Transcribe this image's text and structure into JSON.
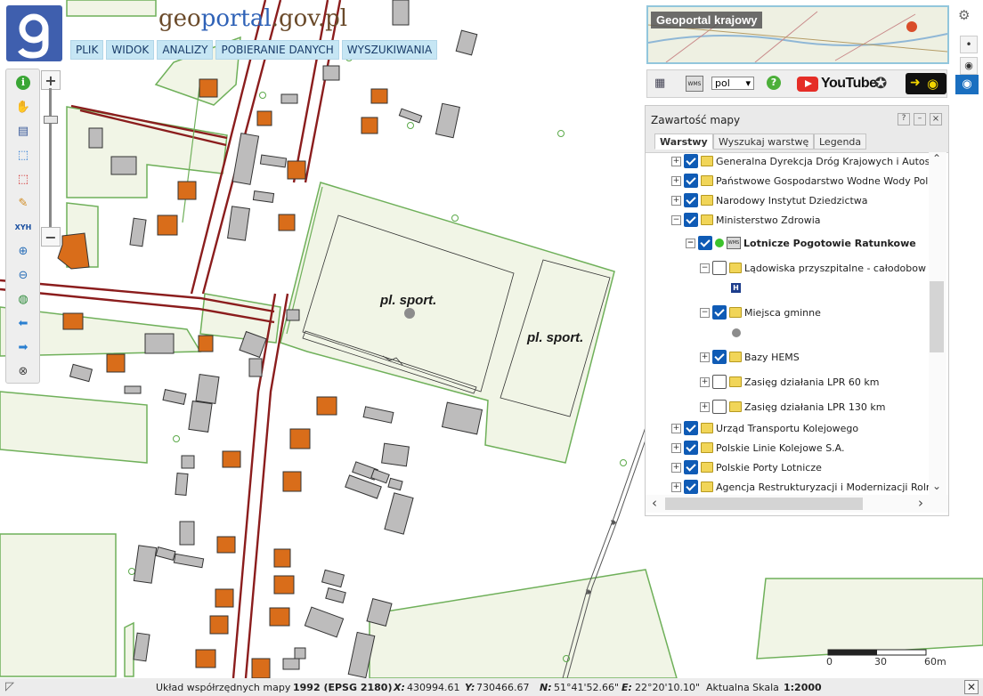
{
  "app": {
    "brand_part1": "geo",
    "brand_part2": "portal",
    "brand_part3": ".gov.pl",
    "logo_glyph": "g"
  },
  "menu": [
    "PLIK",
    "WIDOK",
    "ANALIZY",
    "POBIERANIE DANYCH",
    "WYSZUKIWANIA"
  ],
  "toolbar_tools": [
    {
      "name": "info-icon",
      "glyph": "i"
    },
    {
      "name": "pan-hand-icon",
      "glyph": "✋"
    },
    {
      "name": "legend-list-icon",
      "glyph": "▤"
    },
    {
      "name": "select-rectangle-icon",
      "glyph": "⬚"
    },
    {
      "name": "select-red-icon",
      "glyph": "⬚"
    },
    {
      "name": "pencil-icon",
      "glyph": "✎"
    },
    {
      "name": "xyh-coordinates-icon",
      "glyph": "XYH"
    },
    {
      "name": "zoom-in-icon",
      "glyph": "⊕"
    },
    {
      "name": "zoom-out-icon",
      "glyph": "⊖"
    },
    {
      "name": "globe-icon",
      "glyph": "◍"
    },
    {
      "name": "back-arrow-icon",
      "glyph": "⬅"
    },
    {
      "name": "forward-arrow-icon",
      "glyph": "➡"
    },
    {
      "name": "clear-icon",
      "glyph": "⊗"
    }
  ],
  "zoom": {
    "plus": "+",
    "minus": "−"
  },
  "map_labels": [
    "pl. sport.",
    "pl. sport."
  ],
  "geoportal_krajowy": "Geoportal krajowy",
  "utilbar": {
    "language": "pol",
    "youtube": "YouTube",
    "help_glyph": "?",
    "wms_label": "WMS"
  },
  "panel": {
    "title": "Zawartość mapy",
    "controls": [
      "?",
      "–",
      "×"
    ],
    "tabs": [
      "Warstwy",
      "Wyszukaj warstwę",
      "Legenda"
    ],
    "layers": [
      {
        "label": "Generalna Dyrekcja Dróg Krajowych i Autost",
        "checked": true,
        "expander": "+",
        "level": 0
      },
      {
        "label": "Państwowe Gospodarstwo Wodne Wody Pol",
        "checked": true,
        "expander": "+",
        "level": 0
      },
      {
        "label": "Narodowy Instytut Dziedzictwa",
        "checked": true,
        "expander": "+",
        "level": 0
      },
      {
        "label": "Ministerstwo Zdrowia",
        "checked": true,
        "expander": "−",
        "level": 0
      },
      {
        "label": "Lotnicze Pogotowie Ratunkowe",
        "checked": true,
        "expander": "−",
        "level": 1
      },
      {
        "label": "Lądowiska przyszpitalne - całodobow",
        "checked": false,
        "expander": "−",
        "level": 2
      },
      {
        "label": "Miejsca gminne",
        "checked": true,
        "expander": "−",
        "level": 2
      },
      {
        "label": "Bazy HEMS",
        "checked": true,
        "expander": "+",
        "level": 2
      },
      {
        "label": "Zasięg działania LPR 60 km",
        "checked": false,
        "expander": "+",
        "level": 2
      },
      {
        "label": "Zasięg działania LPR 130 km",
        "checked": false,
        "expander": "+",
        "level": 2
      },
      {
        "label": "Urząd Transportu Kolejowego",
        "checked": true,
        "expander": "+",
        "level": 0
      },
      {
        "label": "Polskie Linie Kolejowe S.A.",
        "checked": true,
        "expander": "+",
        "level": 0
      },
      {
        "label": "Polskie Porty Lotnicze",
        "checked": true,
        "expander": "+",
        "level": 0
      },
      {
        "label": "Agencja Restrukturyzacji i Modernizacji Rolr",
        "checked": true,
        "expander": "+",
        "level": 0
      }
    ],
    "legend_symbol_h": "H",
    "scroll_glyphs": {
      "up": "⌃",
      "down": "⌄",
      "left": "‹",
      "right": "›"
    }
  },
  "scalebar": {
    "labels": [
      "0",
      "30",
      "60m"
    ]
  },
  "status": {
    "system_prefix": "Układ współrzędnych mapy",
    "system_value": "1992 (EPSG 2180)",
    "x_label": "X:",
    "x_value": "430994.61",
    "y_label": "Y:",
    "y_value": "730466.67",
    "n_label": "N:",
    "n_value": "51°41'52.66\"",
    "e_label": "E:",
    "e_value": "22°20'10.10\"",
    "scale_label": "Aktualna Skala",
    "scale_value": "1:2000"
  }
}
